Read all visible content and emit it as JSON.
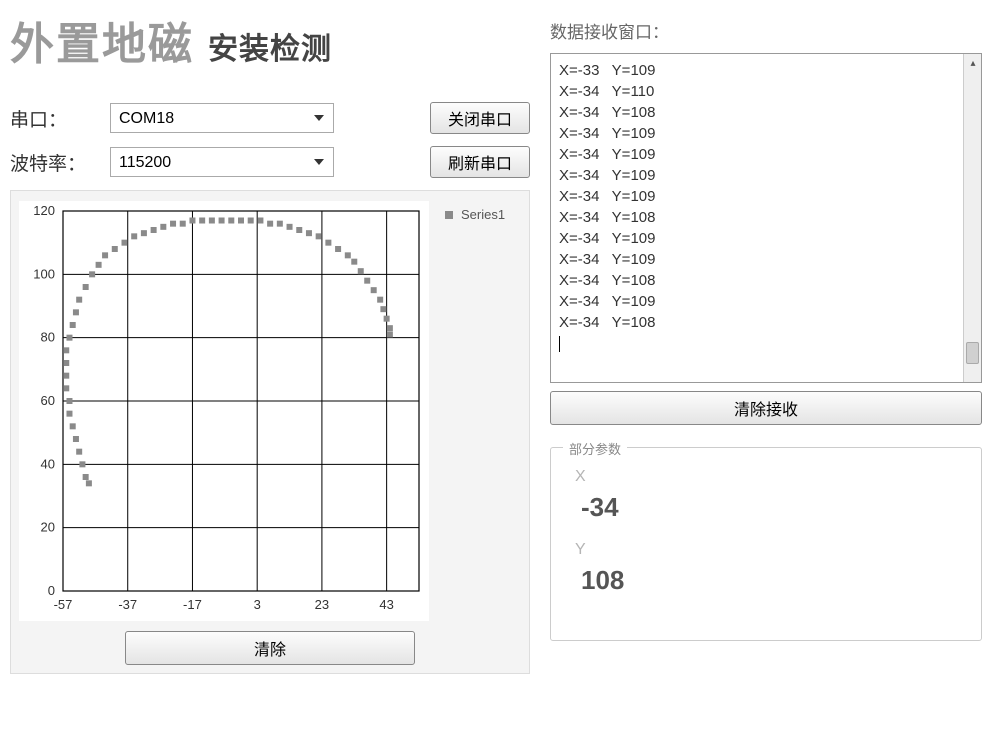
{
  "title": {
    "main": "外置地磁",
    "sub": "安装检测"
  },
  "form": {
    "port_label": "串口：",
    "port_value": "COM18",
    "baud_label": "波特率：",
    "baud_value": "115200",
    "close_port_btn": "关闭串口",
    "refresh_port_btn": "刷新串口"
  },
  "chart_clear_btn": "清除",
  "legend": {
    "series1": "Series1"
  },
  "recv": {
    "label": "数据接收窗口：",
    "lines": [
      "X=-33   Y=109",
      "X=-34   Y=110",
      "X=-34   Y=108",
      "X=-34   Y=109",
      "X=-34   Y=109",
      "X=-34   Y=109",
      "X=-34   Y=109",
      "X=-34   Y=108",
      "X=-34   Y=109",
      "X=-34   Y=109",
      "X=-34   Y=108",
      "X=-34   Y=109",
      "X=-34   Y=108"
    ],
    "clear_btn": "清除接收"
  },
  "params": {
    "legend": "部分参数",
    "x_label": "X",
    "x_value": "-34",
    "y_label": "Y",
    "y_value": "108"
  },
  "chart_data": {
    "type": "scatter",
    "series": [
      {
        "name": "Series1",
        "points": [
          {
            "x": -56,
            "y": 76
          },
          {
            "x": -56,
            "y": 72
          },
          {
            "x": -56,
            "y": 68
          },
          {
            "x": -56,
            "y": 64
          },
          {
            "x": -55,
            "y": 80
          },
          {
            "x": -55,
            "y": 60
          },
          {
            "x": -55,
            "y": 56
          },
          {
            "x": -54,
            "y": 52
          },
          {
            "x": -54,
            "y": 84
          },
          {
            "x": -53,
            "y": 48
          },
          {
            "x": -52,
            "y": 44
          },
          {
            "x": -51,
            "y": 40
          },
          {
            "x": -50,
            "y": 36
          },
          {
            "x": -49,
            "y": 34
          },
          {
            "x": -53,
            "y": 88
          },
          {
            "x": -52,
            "y": 92
          },
          {
            "x": -50,
            "y": 96
          },
          {
            "x": -48,
            "y": 100
          },
          {
            "x": -46,
            "y": 103
          },
          {
            "x": -44,
            "y": 106
          },
          {
            "x": -41,
            "y": 108
          },
          {
            "x": -38,
            "y": 110
          },
          {
            "x": -35,
            "y": 112
          },
          {
            "x": -32,
            "y": 113
          },
          {
            "x": -29,
            "y": 114
          },
          {
            "x": -26,
            "y": 115
          },
          {
            "x": -23,
            "y": 116
          },
          {
            "x": -20,
            "y": 116
          },
          {
            "x": -17,
            "y": 117
          },
          {
            "x": -14,
            "y": 117
          },
          {
            "x": -11,
            "y": 117
          },
          {
            "x": -8,
            "y": 117
          },
          {
            "x": -5,
            "y": 117
          },
          {
            "x": -2,
            "y": 117
          },
          {
            "x": 1,
            "y": 117
          },
          {
            "x": 4,
            "y": 117
          },
          {
            "x": 7,
            "y": 116
          },
          {
            "x": 10,
            "y": 116
          },
          {
            "x": 13,
            "y": 115
          },
          {
            "x": 16,
            "y": 114
          },
          {
            "x": 19,
            "y": 113
          },
          {
            "x": 22,
            "y": 112
          },
          {
            "x": 25,
            "y": 110
          },
          {
            "x": 28,
            "y": 108
          },
          {
            "x": 31,
            "y": 106
          },
          {
            "x": 33,
            "y": 104
          },
          {
            "x": 35,
            "y": 101
          },
          {
            "x": 37,
            "y": 98
          },
          {
            "x": 39,
            "y": 95
          },
          {
            "x": 41,
            "y": 92
          },
          {
            "x": 42,
            "y": 89
          },
          {
            "x": 43,
            "y": 86
          },
          {
            "x": 44,
            "y": 83
          },
          {
            "x": 44,
            "y": 81
          }
        ]
      }
    ],
    "xlabel": "",
    "ylabel": "",
    "xlim": [
      -57,
      53
    ],
    "ylim": [
      0,
      120
    ],
    "x_ticks": [
      -57,
      -37,
      -17,
      3,
      23,
      43
    ],
    "y_ticks": [
      0,
      20,
      40,
      60,
      80,
      100,
      120
    ]
  }
}
